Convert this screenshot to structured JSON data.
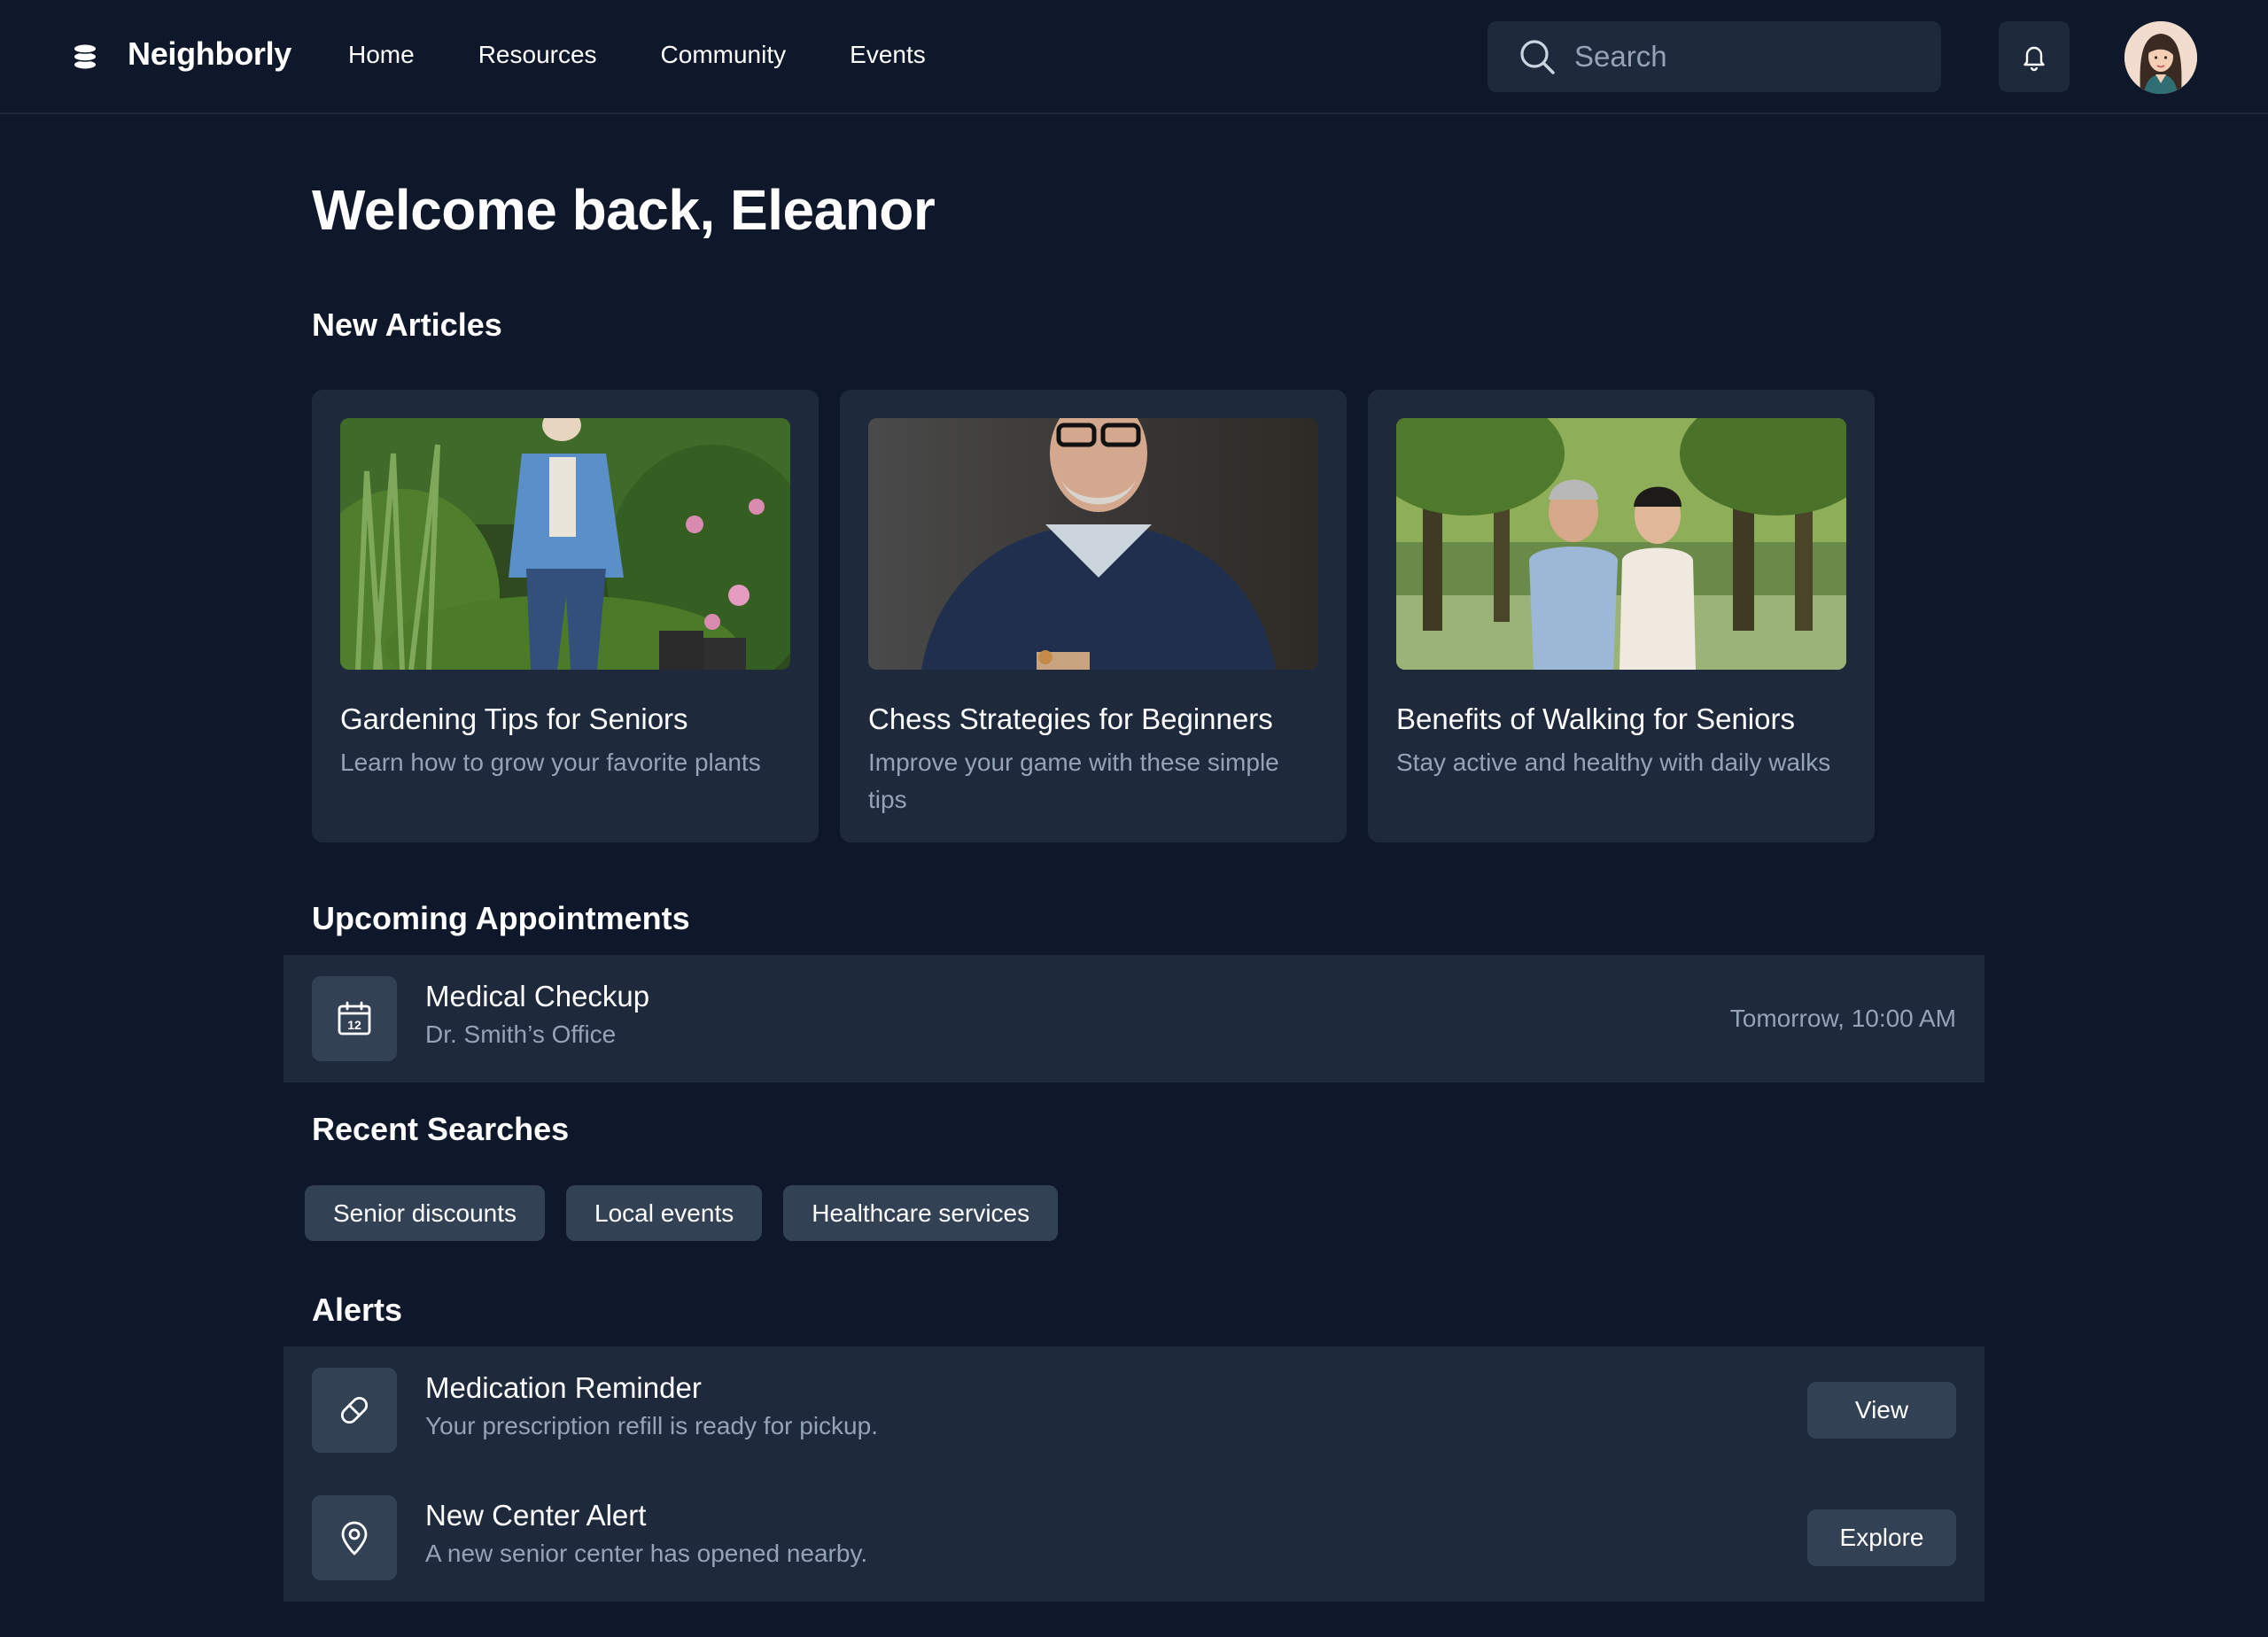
{
  "header": {
    "brand": "Neighborly",
    "nav": [
      "Home",
      "Resources",
      "Community",
      "Events"
    ],
    "search_placeholder": "Search",
    "icons": {
      "logo": "stack-logo-icon",
      "search": "search-icon",
      "notifications": "bell-icon",
      "avatar": "user-avatar"
    }
  },
  "welcome": "Welcome back, Eleanor",
  "articles": {
    "title": "New Articles",
    "items": [
      {
        "title": "Gardening Tips for Seniors",
        "desc": "Learn how to grow your favorite plants"
      },
      {
        "title": "Chess Strategies for Beginners",
        "desc": "Improve your game with these simple tips"
      },
      {
        "title": "Benefits of Walking for Seniors",
        "desc": "Stay active and healthy with daily walks"
      }
    ]
  },
  "appointments": {
    "title": "Upcoming Appointments",
    "items": [
      {
        "title": "Medical Checkup",
        "location": "Dr. Smith’s Office",
        "time": "Tomorrow, 10:00 AM",
        "icon": "calendar-icon",
        "icon_day": "12"
      }
    ]
  },
  "searches": {
    "title": "Recent Searches",
    "items": [
      "Senior discounts",
      "Local events",
      "Healthcare services"
    ]
  },
  "alerts": {
    "title": "Alerts",
    "items": [
      {
        "title": "Medication Reminder",
        "desc": "Your prescription refill is ready for pickup.",
        "button": "View",
        "icon": "pill-icon"
      },
      {
        "title": "New Center Alert",
        "desc": "A new senior center has opened nearby.",
        "button": "Explore",
        "icon": "map-pin-icon"
      }
    ]
  },
  "colors": {
    "background": "#0f172a",
    "surface": "#1e293b",
    "chip": "#334155",
    "muted_text": "#94a3b8"
  }
}
